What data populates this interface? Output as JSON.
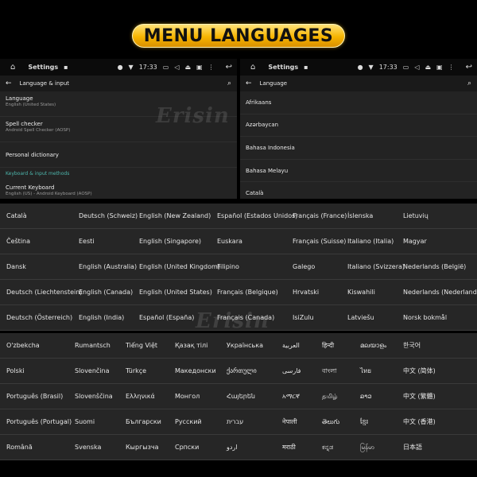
{
  "banner": {
    "text": "MENU LANGUAGES"
  },
  "watermark": "Erisin",
  "left_panel": {
    "statusbar": {
      "title": "Settings",
      "time": "17:33"
    },
    "actionbar": {
      "title": "Language & input"
    },
    "items": [
      {
        "title": "Language",
        "subtitle": "English (United States)"
      },
      {
        "title": "Spell checker",
        "subtitle": "Android Spell Checker (AOSP)"
      },
      {
        "title": "Personal dictionary"
      }
    ],
    "section": "Keyboard & input methods",
    "keyboard": {
      "title": "Current Keyboard",
      "subtitle": "English (US) - Android Keyboard (AOSP)"
    }
  },
  "right_panel": {
    "statusbar": {
      "title": "Settings",
      "time": "17:33"
    },
    "actionbar": {
      "title": "Language"
    },
    "languages": [
      "Afrikaans",
      "Azərbaycan",
      "Bahasa Indonesia",
      "Bahasa Melayu",
      "Català"
    ]
  },
  "grid1": [
    [
      "Català",
      "Deutsch (Schweiz)",
      "English (New Zealand)",
      "Español (Estados Unidos)",
      "Français (France)",
      "Íslenska",
      "Lietuvių"
    ],
    [
      "Čeština",
      "Eesti",
      "English (Singapore)",
      "Euskara",
      "Français (Suisse)",
      "Italiano (Italia)",
      "Magyar"
    ],
    [
      "Dansk",
      "English (Australia)",
      "English (United Kingdom)",
      "Filipino",
      "Galego",
      "Italiano (Svizzera)",
      "Nederlands (België)"
    ],
    [
      "Deutsch (Liechtenstein)",
      "English (Canada)",
      "English (United States)",
      "Français (Belgique)",
      "Hrvatski",
      "Kiswahili",
      "Nederlands (Nederland)"
    ],
    [
      "Deutsch (Österreich)",
      "English (India)",
      "Español (España)",
      "Français (Canada)",
      "IsiZulu",
      "Latviešu",
      "Norsk bokmål"
    ]
  ],
  "grid2": [
    [
      "O'zbekcha",
      "Rumantsch",
      "Tiếng Việt",
      "Қазақ тілі",
      "Українська",
      "العربية",
      "हिन्दी",
      "മലയാളം",
      "한국어"
    ],
    [
      "Polski",
      "Slovenčina",
      "Türkçe",
      "Македонски",
      "ქართული",
      "فارسی",
      "বাংলা",
      "ไทย",
      "中文 (简体)"
    ],
    [
      "Português (Brasil)",
      "Slovenščina",
      "Ελληνικά",
      "Монгол",
      "Հայերեն",
      "አማርኛ",
      "தமிழ்",
      "ລາວ",
      "中文 (繁體)"
    ],
    [
      "Português (Portugal)",
      "Suomi",
      "Български",
      "Русский",
      "עברית",
      "नेपाली",
      "తెలుగు",
      "ខ្មែរ",
      "中文 (香港)"
    ],
    [
      "Română",
      "Svenska",
      "Кыргызча",
      "Српски",
      "اردو",
      "मराठी",
      "ಕನ್ನಡ",
      "မြန်မာ",
      "日本語"
    ]
  ]
}
